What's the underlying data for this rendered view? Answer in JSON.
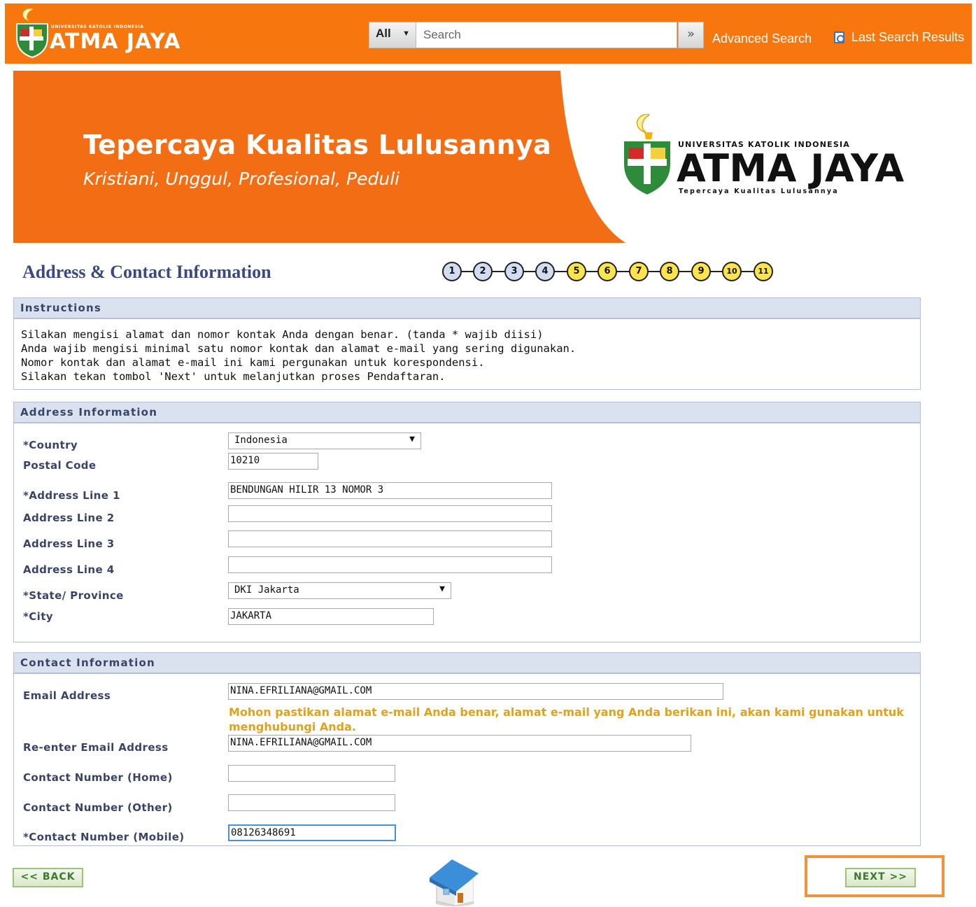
{
  "header": {
    "brand_small_top": "UNIVERSITAS KATOLIK INDONESIA",
    "brand_small": "ATMA JAYA",
    "search_scope": "All",
    "search_placeholder": "Search",
    "search_go": "»",
    "advanced_search": "Advanced Search",
    "last_search": "Last Search Results"
  },
  "banner": {
    "tagline": "Tepercaya Kualitas Lulusannya",
    "subtagline": "Kristiani, Unggul, Profesional, Peduli",
    "university_line": "UNIVERSITAS KATOLIK INDONESIA",
    "university_name": "ATMA JAYA",
    "university_motto": "Tepercaya Kualitas Lulusannya"
  },
  "page": {
    "title": "Address & Contact Information",
    "steps": [
      "1",
      "2",
      "3",
      "4",
      "5",
      "6",
      "7",
      "8",
      "9",
      "10",
      "11"
    ]
  },
  "instructions": {
    "heading": "Instructions",
    "lines": [
      "Silakan mengisi alamat dan nomor kontak Anda dengan benar. (tanda * wajib diisi)",
      "Anda wajib mengisi minimal satu nomor kontak dan alamat e-mail yang sering digunakan.",
      "Nomor kontak dan alamat e-mail ini kami pergunakan untuk korespondensi.",
      "Silakan tekan tombol 'Next' untuk melanjutkan proses Pendaftaran."
    ]
  },
  "address": {
    "heading": "Address Information",
    "country_label": "*Country",
    "country_value": "Indonesia",
    "postal_label": "Postal Code",
    "postal_value": "10210",
    "addr1_label": "*Address Line 1",
    "addr1_value": "BENDUNGAN HILIR 13 NOMOR 3",
    "addr2_label": "Address Line 2",
    "addr2_value": "",
    "addr3_label": "Address Line 3",
    "addr3_value": "",
    "addr4_label": "Address Line 4",
    "addr4_value": "",
    "state_label": "*State/ Province",
    "state_value": "DKI Jakarta",
    "city_label": "*City",
    "city_value": "JAKARTA"
  },
  "contact": {
    "heading": "Contact Information",
    "email_label": "Email Address",
    "email_value": "NINA.EFRILIANA@GMAIL.COM",
    "email_warning": "Mohon pastikan alamat e-mail Anda benar, alamat e-mail yang Anda berikan ini, akan kami gunakan untuk menghubungi Anda.",
    "reemail_label": "Re-enter Email Address",
    "reemail_value": "NINA.EFRILIANA@GMAIL.COM",
    "home_label": "Contact Number (Home)",
    "home_value": "",
    "other_label": "Contact Number (Other)",
    "other_value": "",
    "mobile_label": "*Contact Number (Mobile)",
    "mobile_value": "08126348691"
  },
  "nav": {
    "back": "<< BACK",
    "next": "NEXT >>"
  },
  "colors": {
    "brand_orange": "#f7760e",
    "title_blue": "#3a4a7d",
    "warning_gold": "#e0a21d",
    "button_green": "#3b7a2c"
  },
  "icons": {
    "search_go": "double-chevron-right-icon",
    "last_search": "magnifier-page-icon",
    "home": "home-icon"
  }
}
